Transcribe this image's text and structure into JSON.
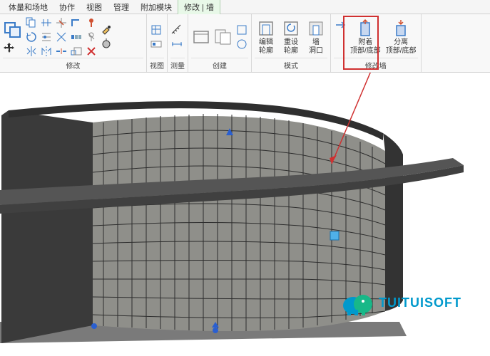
{
  "tabs": {
    "items": [
      {
        "label": "体量和场地"
      },
      {
        "label": "协作"
      },
      {
        "label": "视图"
      },
      {
        "label": "管理"
      },
      {
        "label": "附加模块"
      },
      {
        "label": "修改 | 墙"
      }
    ],
    "active_index": 5
  },
  "ribbon": {
    "panels": {
      "modify": {
        "label": "修改"
      },
      "view": {
        "label": "视图"
      },
      "measure": {
        "label": "测量"
      },
      "create": {
        "label": "创建"
      },
      "mode": {
        "label": "模式",
        "edit_profile": "编辑",
        "edit_profile2": "轮廓",
        "reset_profile": "重设",
        "reset_profile2": "轮廓",
        "wall_opening": "墙",
        "wall_opening2": "洞口"
      },
      "modify_wall": {
        "label": "修改墙",
        "attach": "附着",
        "attach2": "顶部/底部",
        "detach": "分离",
        "detach2": "顶部/底部"
      }
    }
  },
  "watermark": {
    "text": "TUITUISOFT"
  }
}
